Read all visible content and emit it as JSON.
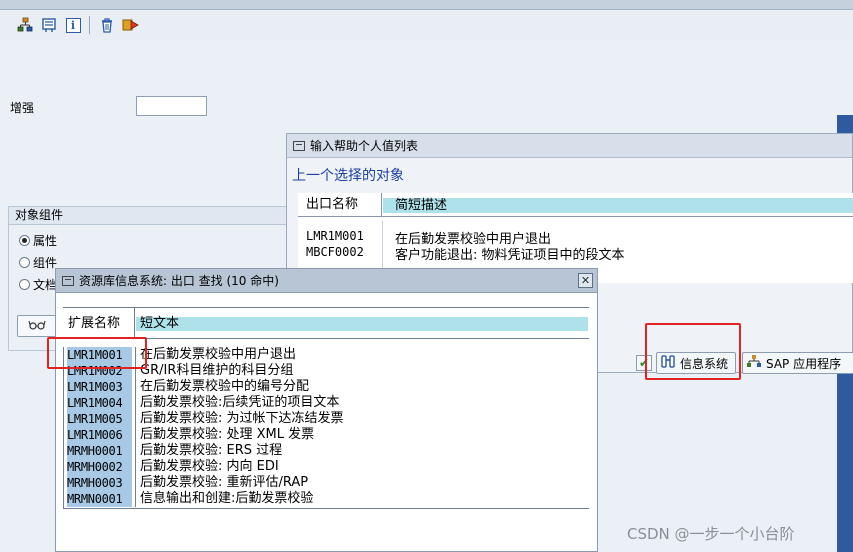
{
  "toolbar": {
    "icons": [
      "hierarchy-icon",
      "display-icon",
      "info-icon",
      "trash-icon",
      "transport-icon"
    ]
  },
  "main": {
    "enhancement_label": "增强",
    "enhancement_value": "",
    "object_components": {
      "title": "对象组件",
      "options": [
        "属性",
        "组件",
        "文档"
      ],
      "selected": "属性"
    }
  },
  "popup_values": {
    "title": "输入帮助个人值列表",
    "subtitle": "上一个选择的对象",
    "columns": [
      "出口名称",
      "简短描述"
    ],
    "rows": [
      {
        "code": "LMR1M001",
        "desc": "在后勤发票校验中用户退出"
      },
      {
        "code": "MBCF0002",
        "desc": "客户功能退出: 物料凭证项目中的段文本"
      }
    ],
    "buttons": {
      "info_system": "信息系统",
      "sap_app": "SAP 应用程序"
    }
  },
  "popup_repo": {
    "title": "资源库信息系统: 出口 查找 (10 命中)",
    "close": "✕",
    "columns": [
      "扩展名称",
      "短文本"
    ],
    "rows": [
      {
        "code": "LMR1M001",
        "desc": "在后勤发票校验中用户退出"
      },
      {
        "code": "LMR1M002",
        "desc": "GR/IR科目维护的科目分组"
      },
      {
        "code": "LMR1M003",
        "desc": "在后勤发票校验中的编号分配"
      },
      {
        "code": "LMR1M004",
        "desc": "后勤发票校验:后续凭证的项目文本"
      },
      {
        "code": "LMR1M005",
        "desc": "后勤发票校验: 为过帐下达冻结发票"
      },
      {
        "code": "LMR1M006",
        "desc": "后勤发票校验: 处理 XML 发票"
      },
      {
        "code": "MRMH0001",
        "desc": "后勤发票校验: ERS 过程"
      },
      {
        "code": "MRMH0002",
        "desc": "后勤发票校验: 内向 EDI"
      },
      {
        "code": "MRMH0003",
        "desc": "后勤发票校验: 重新评估/RAP"
      },
      {
        "code": "MRMN0001",
        "desc": "信息输出和创建:后勤发票校验"
      }
    ]
  },
  "watermark": "CSDN @一步一个小台阶",
  "colors": {
    "highlight": "#e32222",
    "header_cyan": "#aee1ea",
    "code_bg": "#a7c9e6"
  }
}
